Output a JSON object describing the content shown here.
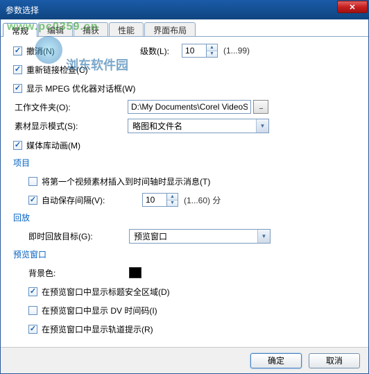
{
  "window": {
    "title": "参数选择"
  },
  "tabs": [
    "常规",
    "编辑",
    "捕获",
    "性能",
    "界面布局"
  ],
  "active_tab": 0,
  "watermark": {
    "url": "www.pc0359.cn",
    "cn": "浏东软件园"
  },
  "general": {
    "undo": {
      "label": "撤消(N)",
      "checked": true
    },
    "levels_label": "级数(L):",
    "levels_value": "10",
    "levels_hint": "(1...99)",
    "relink": {
      "label": "重新链接检查(C)",
      "checked": true
    },
    "mpeg": {
      "label": "显示 MPEG 优化器对话框(W)",
      "checked": true
    },
    "workfolder_label": "工作文件夹(O):",
    "workfolder_value": "D:\\My Documents\\Corel VideoS",
    "display_mode_label": "素材显示模式(S):",
    "display_mode_value": "略图和文件名",
    "media_anim": {
      "label": "媒体库动画(M)",
      "checked": true
    }
  },
  "project": {
    "header": "项目",
    "insert_msg": {
      "label": "将第一个视频素材插入到时间轴时显示消息(T)",
      "checked": false
    },
    "autosave": {
      "label": "自动保存间隔(V):",
      "checked": true,
      "value": "10",
      "hint": "(1...60) 分"
    }
  },
  "playback": {
    "header": "回放",
    "target_label": "即时回放目标(G):",
    "target_value": "预览窗口"
  },
  "preview": {
    "header": "预览窗口",
    "bgcolor_label": "背景色:",
    "safe_area": {
      "label": "在预览窗口中显示标题安全区域(D)",
      "checked": true
    },
    "dv_timecode": {
      "label": "在预览窗口中显示 DV 时间码(I)",
      "checked": false
    },
    "track_hint": {
      "label": "在预览窗口中显示轨道提示(R)",
      "checked": true
    }
  },
  "footer": {
    "ok": "确定",
    "cancel": "取消"
  }
}
